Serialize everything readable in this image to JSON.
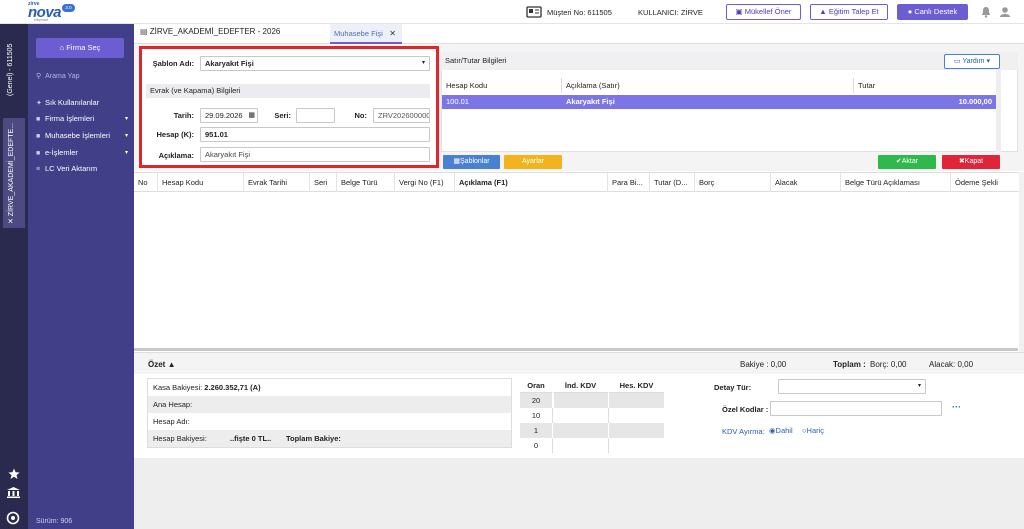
{
  "brand": {
    "small": "zirve",
    "name": "nova",
    "version": "3.0",
    "sub": "bilişimsel"
  },
  "topbar": {
    "musteri": "Müşteri No: 611505",
    "kullanici": "KULLANICI: ZİRVE",
    "mukellef_btn": "Mükellef Öner",
    "egitim_btn": "Eğitim Talep Et",
    "canli_btn": "Canlı Destek"
  },
  "rail": {
    "tab1": "(Genel) - 611505",
    "tab2": "ZİRVE_AKADEMİ_EDEFTE..."
  },
  "sidebar": {
    "firma_sec": "Firma Seç",
    "search_placeholder": "Arama Yap",
    "items": [
      {
        "label": "Sık Kullanılanlar",
        "has_arrow": false
      },
      {
        "label": "Firma İşlemleri",
        "has_arrow": true
      },
      {
        "label": "Muhasebe İşlemleri",
        "has_arrow": true
      },
      {
        "label": "e-İşlemler",
        "has_arrow": true
      },
      {
        "label": "LC Veri Aktarım",
        "has_arrow": false
      }
    ],
    "surum": "Sürüm: 906"
  },
  "tabs": {
    "company": "ZİRVE_AKADEMİ_EDEFTER - 2026",
    "active": "Muhasebe Fişi"
  },
  "form": {
    "sablon_label": "Şablon Adı:",
    "sablon_value": "Akaryakıt Fişi",
    "evrak_header": "Evrak (ve Kapama) Bilgileri",
    "tarih_label": "Tarih:",
    "tarih_value": "29.09.2026",
    "seri_label": "Seri:",
    "seri_value": "",
    "no_label": "No:",
    "no_value": "ZRV202600000",
    "hesap_label": "Hesap (K):",
    "hesap_value": "951.01",
    "aciklama_label": "Açıklama:",
    "aciklama_value": "Akaryakıt Fişi"
  },
  "satir": {
    "title": "Satır/Tutar Bilgileri",
    "yardim": "Yardım",
    "columns": [
      "Hesap Kodu",
      "Açıklama (Satır)",
      "Tutar"
    ],
    "row": {
      "hesap": "100.01",
      "aciklama": "Akaryakıt Fişi",
      "tutar": "10.000,00"
    },
    "sablonlar_btn": "Şablonlar",
    "ayarlar_btn": "Ayarlar",
    "aktar_btn": "Aktar",
    "kapat_btn": "Kapat"
  },
  "grid": {
    "columns": [
      "No",
      "Hesap Kodu",
      "Evrak Tarihi",
      "Seri",
      "Belge Türü",
      "Vergi No (F1)",
      "Açıklama (F1)",
      "Para Bi...",
      "Tutar (D...",
      "Borç",
      "Alacak",
      "Belge Türü Açıklaması",
      "Ödeme Şekli"
    ]
  },
  "ozet": {
    "title": "Özet",
    "bakiye": "Bakiye : 0,00",
    "toplam_label": "Toplam :",
    "borc": "Borç: 0,00",
    "alacak": "Alacak: 0,00",
    "kasa_label": "Kasa Bakiyesi:",
    "kasa_value": "2.260.352,71 (A)",
    "ana_hesap": "Ana Hesap:",
    "hesap_adi": "Hesap Adı:",
    "hesap_bakiyesi": "Hesap Bakiyesi:",
    "fis_text": "..fişte 0 TL..",
    "toplam_bakiye": "Toplam Bakiye:",
    "oran_headers": [
      "Oran",
      "İnd. KDV",
      "Hes. KDV"
    ],
    "oran_values": [
      "20",
      "10",
      "1",
      "0"
    ],
    "detay_label": "Detay Tür:",
    "ozel_label": "Özel Kodlar :",
    "kdv_label": "KDV Ayırma:",
    "dahil": "Dahil",
    "haric": "Hariç"
  },
  "colors": {
    "sidebar": "#413f88",
    "rail": "#2a2a4e",
    "accent": "#6d5dd3",
    "selected_row": "#7c75e6",
    "highlight_box": "#e0252b",
    "aktar": "#2fb84c",
    "kapat": "#e0253a",
    "ayarlar": "#f2b31c",
    "sablonlar": "#4a80d0"
  }
}
